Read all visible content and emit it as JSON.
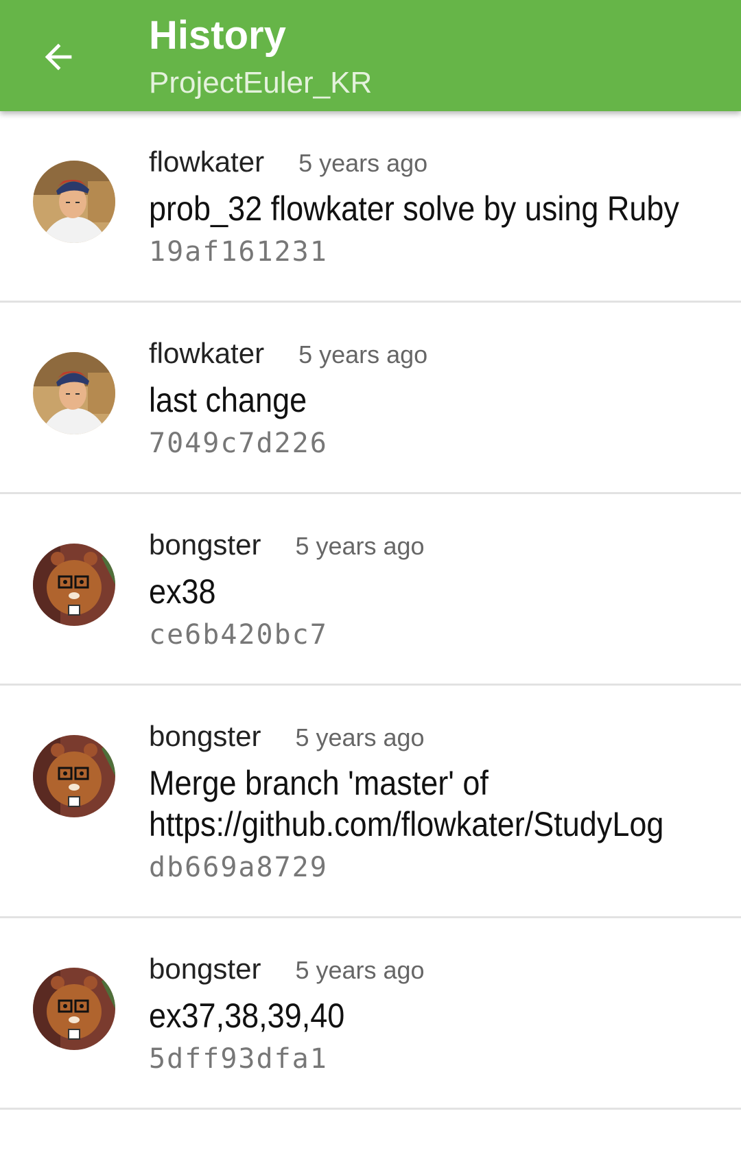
{
  "app_bar": {
    "title": "History",
    "subtitle": "ProjectEuler_KR",
    "back_icon": "arrow-back-icon",
    "color": "#66b548"
  },
  "commits": [
    {
      "author": "flowkater",
      "time": "5 years ago",
      "message": "prob_32 flowkater solve by using Ruby",
      "sha": "19af161231",
      "avatar": "person-photo"
    },
    {
      "author": "flowkater",
      "time": "5 years ago",
      "message": "last change",
      "sha": "7049c7d226",
      "avatar": "person-photo"
    },
    {
      "author": "bongster",
      "time": "5 years ago",
      "message": "ex38",
      "sha": "ce6b420bc7",
      "avatar": "bear-cartoon"
    },
    {
      "author": "bongster",
      "time": "5 years ago",
      "message": "Merge branch 'master' of https://github.com/flowkater/StudyLog",
      "sha": "db669a8729",
      "avatar": "bear-cartoon"
    },
    {
      "author": "bongster",
      "time": "5 years ago",
      "message": "ex37,38,39,40",
      "sha": "5dff93dfa1",
      "avatar": "bear-cartoon"
    }
  ]
}
